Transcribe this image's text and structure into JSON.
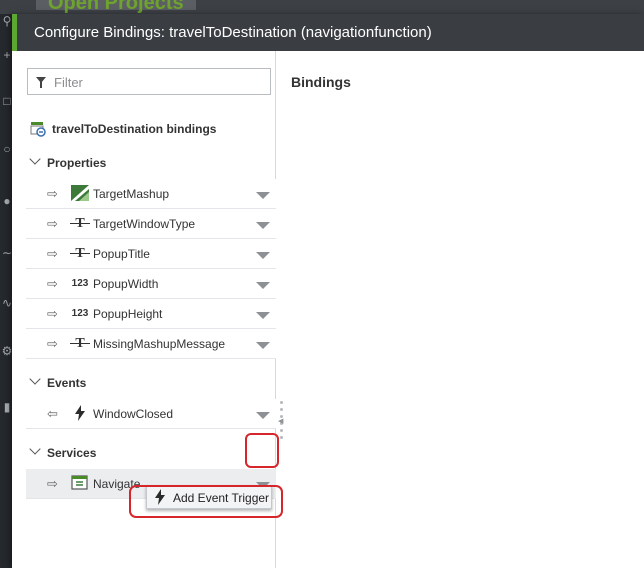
{
  "background": {
    "app_title": "Open Projects"
  },
  "dialog": {
    "title": "Configure Bindings: travelToDestination (navigationfunction)"
  },
  "filter": {
    "placeholder": "Filter"
  },
  "entity": {
    "label": "travelToDestination bindings",
    "icon": "binding-entity-icon"
  },
  "sections": {
    "properties": "Properties",
    "events": "Events",
    "services": "Services"
  },
  "properties": [
    {
      "label": "TargetMashup",
      "type_icon": "mashup-icon",
      "direction": "input-arrow-icon"
    },
    {
      "label": "TargetWindowType",
      "type_icon": "text-type-icon",
      "type_glyph": "T",
      "direction": "input-arrow-icon"
    },
    {
      "label": "PopupTitle",
      "type_icon": "text-type-icon",
      "type_glyph": "T",
      "direction": "input-arrow-icon"
    },
    {
      "label": "PopupWidth",
      "type_icon": "number-type-icon",
      "type_glyph": "123",
      "direction": "input-arrow-icon"
    },
    {
      "label": "PopupHeight",
      "type_icon": "number-type-icon",
      "type_glyph": "123",
      "direction": "input-arrow-icon"
    },
    {
      "label": "MissingMashupMessage",
      "type_icon": "text-type-icon",
      "type_glyph": "T",
      "direction": "input-arrow-icon"
    }
  ],
  "events": [
    {
      "label": "WindowClosed",
      "type_icon": "lightning-bolt-icon",
      "direction": "output-arrow-icon"
    }
  ],
  "services": [
    {
      "label": "Navigate",
      "type_icon": "service-icon",
      "direction": "input-arrow-icon"
    }
  ],
  "bindings_panel": {
    "title": "Bindings"
  },
  "context_menu": {
    "item": "Add Event Trigger"
  },
  "colors": {
    "header_bg": "#3a3e43",
    "accent_green": "#5aa832",
    "highlight_red": "#d6262b"
  }
}
